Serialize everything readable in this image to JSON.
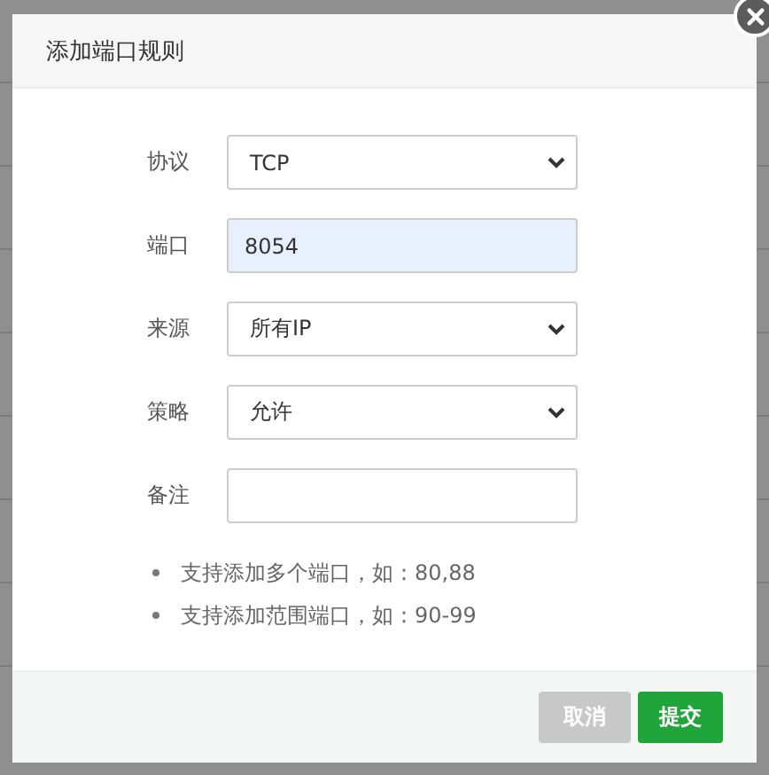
{
  "dialog": {
    "title": "添加端口规则",
    "fields": [
      {
        "label": "协议",
        "kind": "select",
        "value": "TCP",
        "highlighted": false
      },
      {
        "label": "端口",
        "kind": "input",
        "value": "8054",
        "highlighted": true
      },
      {
        "label": "来源",
        "kind": "select",
        "value": "所有IP",
        "highlighted": false
      },
      {
        "label": "策略",
        "kind": "select",
        "value": "允许",
        "highlighted": false
      },
      {
        "label": "备注",
        "kind": "input",
        "highlighted": false
      }
    ],
    "tips": [
      "支持添加多个端口，如：80,88",
      "支持添加范围端口，如：90-99"
    ],
    "buttons": [
      {
        "label": "取消",
        "kind": "cancel"
      },
      {
        "label": "提交",
        "kind": "primary"
      }
    ]
  }
}
